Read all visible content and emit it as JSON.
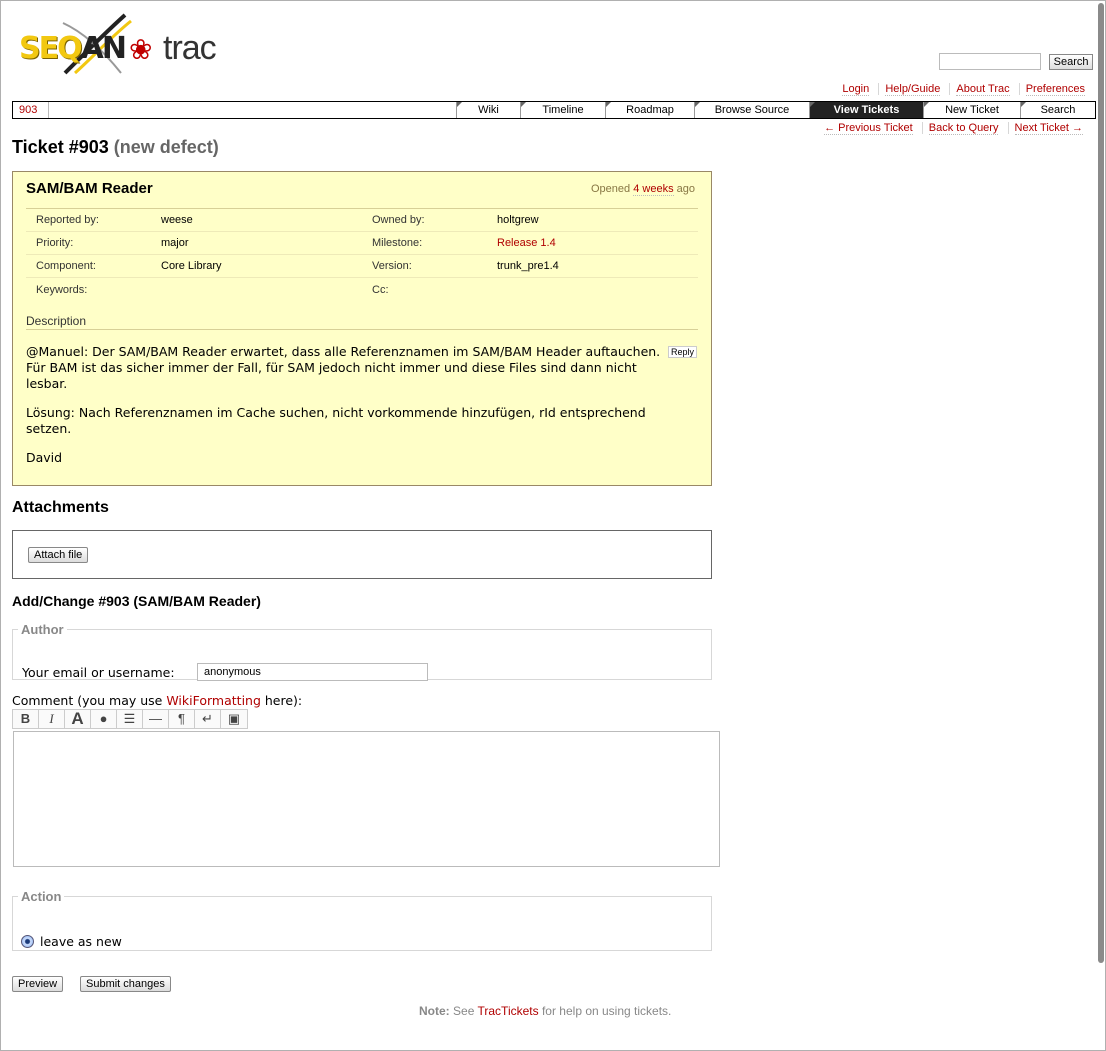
{
  "logo": {
    "seq": "SEQ",
    "an": "AN",
    "trac": "trac"
  },
  "search": {
    "placeholder": "",
    "button": "Search"
  },
  "metanav": [
    "Login",
    "Help/Guide",
    "About Trac",
    "Preferences"
  ],
  "mainnav": {
    "context": "903",
    "tabs": [
      "Wiki",
      "Timeline",
      "Roadmap",
      "Browse Source",
      "View Tickets",
      "New Ticket",
      "Search"
    ],
    "active": "View Tickets"
  },
  "ctxtnav": {
    "prev": "← Previous Ticket",
    "back": "Back to Query",
    "next": "Next Ticket →"
  },
  "ticket": {
    "heading": "Ticket #903",
    "status": "(new defect)",
    "summary": "SAM/BAM Reader",
    "opened_prefix": "Opened",
    "opened_link": "4 weeks",
    "opened_suffix": "ago",
    "props": {
      "reported_by_label": "Reported by:",
      "reported_by": "weese",
      "owned_by_label": "Owned by:",
      "owned_by": "holtgrew",
      "priority_label": "Priority:",
      "priority": "major",
      "milestone_label": "Milestone:",
      "milestone": "Release 1.4",
      "component_label": "Component:",
      "component": "Core Library",
      "version_label": "Version:",
      "version": "trunk_pre1.4",
      "keywords_label": "Keywords:",
      "keywords": "",
      "cc_label": "Cc:",
      "cc": ""
    },
    "description_heading": "Description",
    "reply": "Reply",
    "description": [
      "@Manuel: Der SAM/BAM Reader erwartet, dass alle Referenznamen im SAM/BAM Header auftauchen. Für BAM ist das sicher immer der Fall, für SAM jedoch nicht immer und diese Files sind dann nicht lesbar.",
      "Lösung: Nach Referenznamen im Cache suchen, nicht vorkommende hinzufügen, rId entsprechend setzen.",
      "David"
    ]
  },
  "attachments": {
    "heading": "Attachments",
    "button": "Attach file"
  },
  "change": {
    "heading": "Add/Change #903 (SAM/BAM Reader)",
    "author_legend": "Author",
    "author_label": "Your email or username:",
    "author_value": "anonymous",
    "comment_prefix": "Comment (you may use ",
    "comment_link": "WikiFormatting",
    "comment_suffix": " here):",
    "toolbar": [
      "bold-icon",
      "italic-icon",
      "heading-icon",
      "link-icon",
      "code-block-icon",
      "horizontal-rule-icon",
      "paragraph-icon",
      "line-break-icon",
      "image-icon"
    ],
    "action_legend": "Action",
    "action_option": "leave as new",
    "preview": "Preview",
    "submit": "Submit changes"
  },
  "help": {
    "note": "Note:",
    "see": "See",
    "link": "TracTickets",
    "rest": "for help on using tickets."
  }
}
